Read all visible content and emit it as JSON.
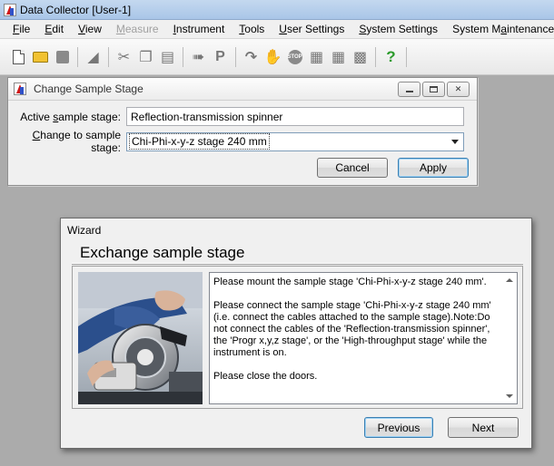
{
  "app": {
    "title": "Data Collector [User-1]"
  },
  "menu": [
    {
      "label": "File",
      "mnemonic": "F",
      "rest": "ile",
      "disabled": false
    },
    {
      "label": "Edit",
      "mnemonic": "E",
      "rest": "dit",
      "disabled": false
    },
    {
      "label": "View",
      "mnemonic": "V",
      "rest": "iew",
      "disabled": false
    },
    {
      "label": "Measure",
      "mnemonic": "M",
      "rest": "easure",
      "disabled": true
    },
    {
      "label": "Instrument",
      "mnemonic": "I",
      "rest": "nstrument",
      "disabled": false
    },
    {
      "label": "Tools",
      "mnemonic": "T",
      "rest": "ools",
      "disabled": false
    },
    {
      "label": "User Settings",
      "mnemonic": "U",
      "rest": "ser Settings",
      "disabled": false
    },
    {
      "label": "System Settings",
      "mnemonic": "S",
      "rest": "ystem Settings",
      "disabled": false
    },
    {
      "label": "System Maintenance",
      "pre": "System M",
      "mnemonic": "a",
      "rest": "intenance",
      "disabled": false
    }
  ],
  "toolbar_icons": [
    "new-document-icon",
    "open-folder-icon",
    "save-icon",
    "erase-icon",
    "cut-icon",
    "copy-icon",
    "paste-icon",
    "run-arrow-icon",
    "p-icon",
    "redo-icon",
    "hand-icon",
    "stop-icon",
    "stage-icon",
    "stage-alt-icon",
    "chart-icon",
    "help-icon"
  ],
  "stage_dialog": {
    "title": "Change Sample Stage",
    "active_label_pre": "Active ",
    "active_label_mn": "s",
    "active_label_post": "ample stage:",
    "active_value": "Reflection-transmission spinner",
    "change_label_mn": "C",
    "change_label_post": "hange to sample stage:",
    "change_value": "Chi-Phi-x-y-z stage 240 mm",
    "cancel_label": "Cancel",
    "apply_label": "Apply"
  },
  "wizard": {
    "title": "Wizard",
    "heading": "Exchange sample stage",
    "paragraphs": [
      "Please mount the sample stage 'Chi-Phi-x-y-z stage 240 mm'.",
      "Please connect the sample stage 'Chi-Phi-x-y-z stage 240 mm' (i.e. connect the cables attached to the sample stage).Note:Do not connect the cables of the 'Reflection-transmission spinner', the 'Progr x,y,z stage', or the 'High-throughput stage' while the instrument is on.",
      "Please close the doors."
    ],
    "previous_label": "Previous",
    "next_label": "Next"
  },
  "colors": {
    "desktop": "#ababab",
    "accent": "#3c7fb1",
    "titlebar": "#b3cde9"
  }
}
